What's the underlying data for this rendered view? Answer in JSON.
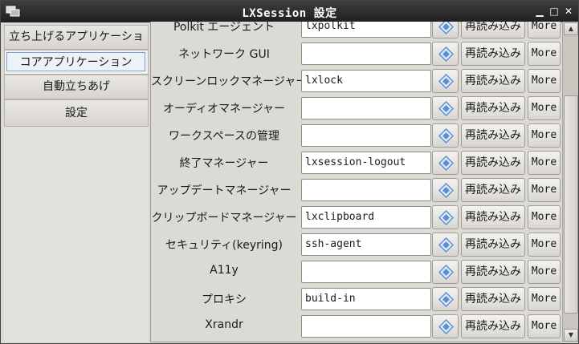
{
  "window": {
    "title": "LXSession 設定",
    "minimize_glyph": "▁",
    "maximize_glyph": "□",
    "close_glyph": "✕"
  },
  "sidebar": {
    "items": [
      {
        "label": "立ち上げるアプリケーション"
      },
      {
        "label": "コアアプリケーション",
        "selected": true
      },
      {
        "label": "自動立ちあげ"
      },
      {
        "label": "設定"
      }
    ]
  },
  "rows": [
    {
      "label": "Polkit エージェント",
      "value": "lxpolkit",
      "reload": "再読み込み",
      "more": "More"
    },
    {
      "label": "ネットワーク GUI",
      "value": "",
      "reload": "再読み込み",
      "more": "More"
    },
    {
      "label": "スクリーンロックマネージャー",
      "value": "lxlock",
      "reload": "再読み込み",
      "more": "More"
    },
    {
      "label": "オーディオマネージャー",
      "value": "",
      "reload": "再読み込み",
      "more": "More"
    },
    {
      "label": "ワークスペースの管理",
      "value": "",
      "reload": "再読み込み",
      "more": "More"
    },
    {
      "label": "終了マネージャー",
      "value": "lxsession-logout",
      "reload": "再読み込み",
      "more": "More"
    },
    {
      "label": "アップデートマネージャー",
      "value": "",
      "reload": "再読み込み",
      "more": "More"
    },
    {
      "label": "クリップボードマネージャー",
      "value": "lxclipboard",
      "reload": "再読み込み",
      "more": "More"
    },
    {
      "label": "セキュリティ(keyring)",
      "value": "ssh-agent",
      "reload": "再読み込み",
      "more": "More"
    },
    {
      "label": "A11y",
      "value": "",
      "reload": "再読み込み",
      "more": "More"
    },
    {
      "label": "プロキシ",
      "value": "build-in",
      "reload": "再読み込み",
      "more": "More"
    },
    {
      "label": "Xrandr",
      "value": "",
      "reload": "再読み込み",
      "more": "More"
    }
  ],
  "colors": {
    "titlebar": "#2b2b2b",
    "diamond_icon": "#5b8fd1",
    "selection_border": "#7a9ed3"
  },
  "icons": {
    "row_button": "diamond-icon",
    "app": "window-icon"
  }
}
